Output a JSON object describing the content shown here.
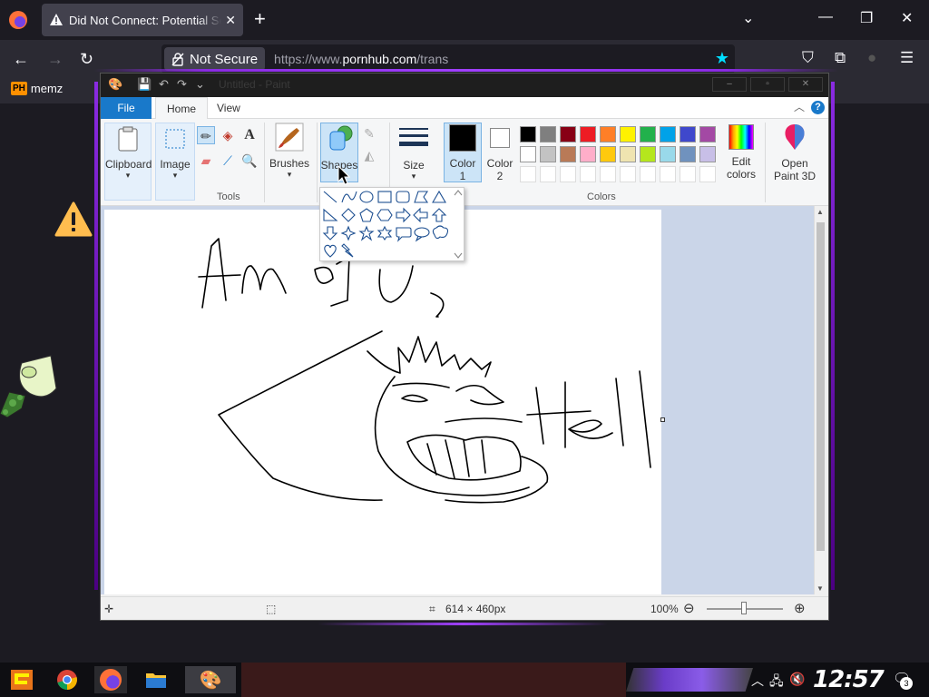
{
  "browser": {
    "tab_title": "Did Not Connect: Potential Security Issue",
    "secure_label": "Not Secure",
    "url_prefix": "https://www.",
    "url_domain": "pornhub.com",
    "url_path": "/trans",
    "bookmark_badge": "PH",
    "bookmark_label": "memz"
  },
  "paint": {
    "window_title": "Untitled - Paint",
    "menu": {
      "file": "File",
      "home": "Home",
      "view": "View",
      "help": "?"
    },
    "ribbon": {
      "clipboard": "Clipboard",
      "image": "Image",
      "tools_group": "Tools",
      "brushes": "Brushes",
      "shapes": "Shapes",
      "size": "Size",
      "color1_line1": "Color",
      "color1_line2": "1",
      "color2_line1": "Color",
      "color2_line2": "2",
      "edit_colors_line1": "Edit",
      "edit_colors_line2": "colors",
      "paint3d_line1": "Open",
      "paint3d_line2": "Paint 3D",
      "colors_group": "Colors",
      "text_tool": "A"
    },
    "palette_row1": [
      "#000000",
      "#7f7f7f",
      "#880015",
      "#ed1c24",
      "#ff7f27",
      "#fff200",
      "#22b14c",
      "#00a2e8",
      "#3f48cc",
      "#a349a4"
    ],
    "palette_row2": [
      "#ffffff",
      "#c3c3c3",
      "#b97a57",
      "#ffaec9",
      "#ffc90e",
      "#efe4b0",
      "#b5e61d",
      "#99d9ea",
      "#7092be",
      "#c8bfe7"
    ],
    "status": {
      "canvas_size": "614 × 460px",
      "zoom": "100%"
    }
  },
  "taskbar": {
    "clock": "12:57 PM",
    "notification_count": "3"
  }
}
